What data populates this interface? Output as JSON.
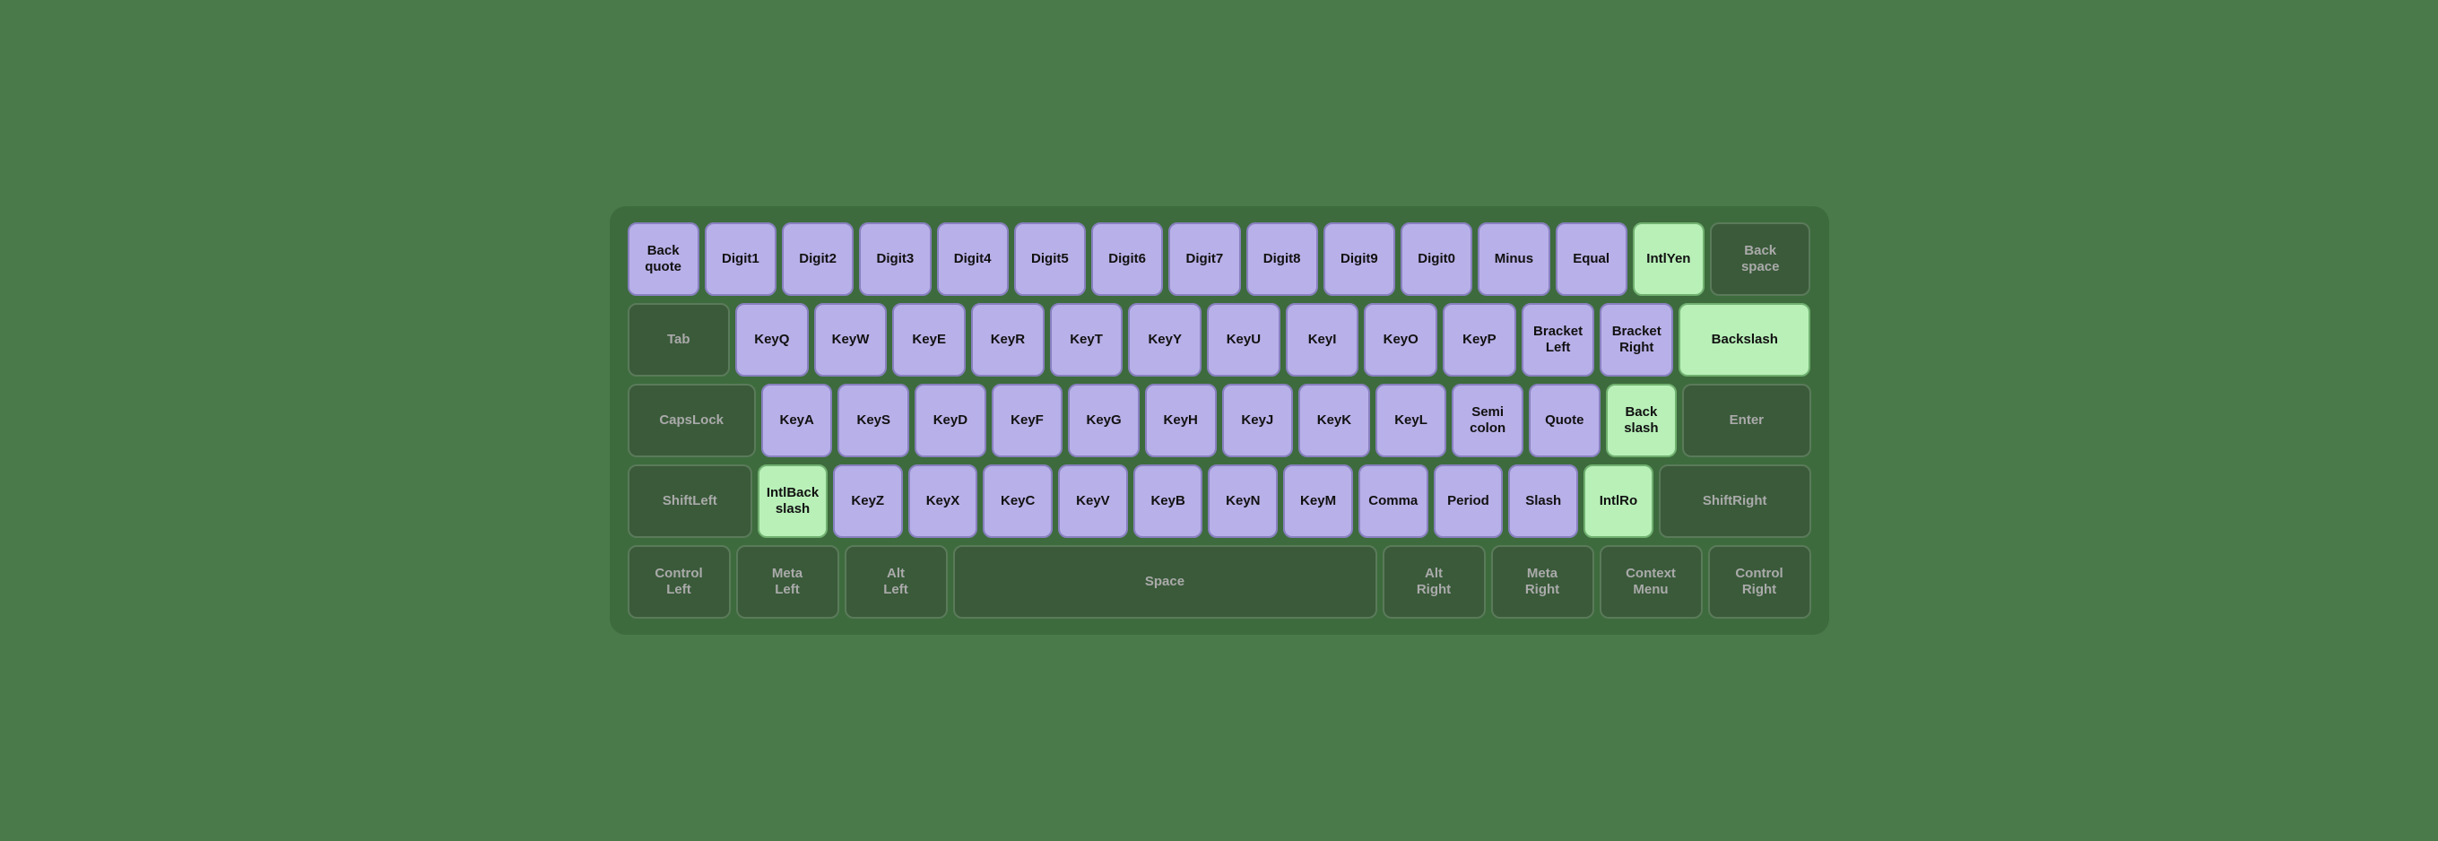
{
  "keyboard": {
    "rows": [
      {
        "id": "row1",
        "keys": [
          {
            "id": "Backquote",
            "label": "Back\nquote",
            "style": "purple",
            "width": "w1"
          },
          {
            "id": "Digit1",
            "label": "Digit1",
            "style": "purple",
            "width": "w1"
          },
          {
            "id": "Digit2",
            "label": "Digit2",
            "style": "purple",
            "width": "w1"
          },
          {
            "id": "Digit3",
            "label": "Digit3",
            "style": "purple",
            "width": "w1"
          },
          {
            "id": "Digit4",
            "label": "Digit4",
            "style": "purple",
            "width": "w1"
          },
          {
            "id": "Digit5",
            "label": "Digit5",
            "style": "purple",
            "width": "w1"
          },
          {
            "id": "Digit6",
            "label": "Digit6",
            "style": "purple",
            "width": "w1"
          },
          {
            "id": "Digit7",
            "label": "Digit7",
            "style": "purple",
            "width": "w1"
          },
          {
            "id": "Digit8",
            "label": "Digit8",
            "style": "purple",
            "width": "w1"
          },
          {
            "id": "Digit9",
            "label": "Digit9",
            "style": "purple",
            "width": "w1"
          },
          {
            "id": "Digit0",
            "label": "Digit0",
            "style": "purple",
            "width": "w1"
          },
          {
            "id": "Minus",
            "label": "Minus",
            "style": "purple",
            "width": "w1"
          },
          {
            "id": "Equal",
            "label": "Equal",
            "style": "purple",
            "width": "w1"
          },
          {
            "id": "IntlYen",
            "label": "IntlYen",
            "style": "green",
            "width": "w1"
          },
          {
            "id": "Backspace",
            "label": "Back\nspace",
            "style": "dark",
            "width": "w1h"
          }
        ]
      },
      {
        "id": "row2",
        "keys": [
          {
            "id": "Tab",
            "label": "Tab",
            "style": "dark",
            "width": "w1h"
          },
          {
            "id": "KeyQ",
            "label": "KeyQ",
            "style": "purple",
            "width": "w1"
          },
          {
            "id": "KeyW",
            "label": "KeyW",
            "style": "purple",
            "width": "w1"
          },
          {
            "id": "KeyE",
            "label": "KeyE",
            "style": "purple",
            "width": "w1"
          },
          {
            "id": "KeyR",
            "label": "KeyR",
            "style": "purple",
            "width": "w1"
          },
          {
            "id": "KeyT",
            "label": "KeyT",
            "style": "purple",
            "width": "w1"
          },
          {
            "id": "KeyY",
            "label": "KeyY",
            "style": "purple",
            "width": "w1"
          },
          {
            "id": "KeyU",
            "label": "KeyU",
            "style": "purple",
            "width": "w1"
          },
          {
            "id": "KeyI",
            "label": "KeyI",
            "style": "purple",
            "width": "w1"
          },
          {
            "id": "KeyO",
            "label": "KeyO",
            "style": "purple",
            "width": "w1"
          },
          {
            "id": "KeyP",
            "label": "KeyP",
            "style": "purple",
            "width": "w1"
          },
          {
            "id": "BracketLeft",
            "label": "Bracket\nLeft",
            "style": "purple",
            "width": "w1"
          },
          {
            "id": "BracketRight",
            "label": "Bracket\nRight",
            "style": "purple",
            "width": "w1"
          },
          {
            "id": "Backslash",
            "label": "Backslash",
            "style": "green",
            "width": "w2"
          }
        ]
      },
      {
        "id": "row3",
        "keys": [
          {
            "id": "CapsLock",
            "label": "CapsLock",
            "style": "dark",
            "width": "w2"
          },
          {
            "id": "KeyA",
            "label": "KeyA",
            "style": "purple",
            "width": "w1"
          },
          {
            "id": "KeyS",
            "label": "KeyS",
            "style": "purple",
            "width": "w1"
          },
          {
            "id": "KeyD",
            "label": "KeyD",
            "style": "purple",
            "width": "w1"
          },
          {
            "id": "KeyF",
            "label": "KeyF",
            "style": "purple",
            "width": "w1"
          },
          {
            "id": "KeyG",
            "label": "KeyG",
            "style": "purple",
            "width": "w1"
          },
          {
            "id": "KeyH",
            "label": "KeyH",
            "style": "purple",
            "width": "w1"
          },
          {
            "id": "KeyJ",
            "label": "KeyJ",
            "style": "purple",
            "width": "w1"
          },
          {
            "id": "KeyK",
            "label": "KeyK",
            "style": "purple",
            "width": "w1"
          },
          {
            "id": "KeyL",
            "label": "KeyL",
            "style": "purple",
            "width": "w1"
          },
          {
            "id": "Semicolon",
            "label": "Semi\ncolon",
            "style": "purple",
            "width": "w1"
          },
          {
            "id": "Quote",
            "label": "Quote",
            "style": "purple",
            "width": "w1"
          },
          {
            "id": "Backslash2",
            "label": "Back\nslash",
            "style": "green",
            "width": "w1"
          },
          {
            "id": "Enter",
            "label": "Enter",
            "style": "dark",
            "width": "w2"
          }
        ]
      },
      {
        "id": "row4",
        "keys": [
          {
            "id": "ShiftLeft",
            "label": "ShiftLeft",
            "style": "dark",
            "width": "w2"
          },
          {
            "id": "IntlBackslash",
            "label": "IntlBack\nslash",
            "style": "green",
            "width": "w1"
          },
          {
            "id": "KeyZ",
            "label": "KeyZ",
            "style": "purple",
            "width": "w1"
          },
          {
            "id": "KeyX",
            "label": "KeyX",
            "style": "purple",
            "width": "w1"
          },
          {
            "id": "KeyC",
            "label": "KeyC",
            "style": "purple",
            "width": "w1"
          },
          {
            "id": "KeyV",
            "label": "KeyV",
            "style": "purple",
            "width": "w1"
          },
          {
            "id": "KeyB",
            "label": "KeyB",
            "style": "purple",
            "width": "w1"
          },
          {
            "id": "KeyN",
            "label": "KeyN",
            "style": "purple",
            "width": "w1"
          },
          {
            "id": "KeyM",
            "label": "KeyM",
            "style": "purple",
            "width": "w1"
          },
          {
            "id": "Comma",
            "label": "Comma",
            "style": "purple",
            "width": "w1"
          },
          {
            "id": "Period",
            "label": "Period",
            "style": "purple",
            "width": "w1"
          },
          {
            "id": "Slash",
            "label": "Slash",
            "style": "purple",
            "width": "w1"
          },
          {
            "id": "IntlRo",
            "label": "IntlRo",
            "style": "green",
            "width": "w1"
          },
          {
            "id": "ShiftRight",
            "label": "ShiftRight",
            "style": "dark",
            "width": "w2h"
          }
        ]
      },
      {
        "id": "row5",
        "keys": [
          {
            "id": "ControlLeft",
            "label": "Control\nLeft",
            "style": "dark",
            "width": "w1h"
          },
          {
            "id": "MetaLeft",
            "label": "Meta\nLeft",
            "style": "dark",
            "width": "w1h"
          },
          {
            "id": "AltLeft",
            "label": "Alt\nLeft",
            "style": "dark",
            "width": "w1h"
          },
          {
            "id": "Space",
            "label": "Space",
            "style": "dark",
            "width": "wspace"
          },
          {
            "id": "AltRight",
            "label": "Alt\nRight",
            "style": "dark",
            "width": "w1h"
          },
          {
            "id": "MetaRight",
            "label": "Meta\nRight",
            "style": "dark",
            "width": "w1h"
          },
          {
            "id": "ContextMenu",
            "label": "Context\nMenu",
            "style": "dark",
            "width": "w1h"
          },
          {
            "id": "ControlRight",
            "label": "Control\nRight",
            "style": "dark",
            "width": "w1h"
          }
        ]
      }
    ]
  }
}
